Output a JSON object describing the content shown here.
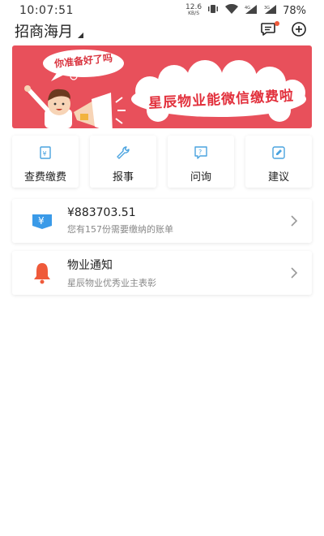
{
  "status_bar": {
    "time": "10:07:51",
    "net_speed_value": "12.6",
    "net_speed_unit": "KB/S",
    "battery": "78%",
    "icons": [
      "vibrate-icon",
      "wifi-icon",
      "signal-4g-icon",
      "signal-3g-icon"
    ]
  },
  "header": {
    "location": "招商海月",
    "icons": [
      "message-icon",
      "add-circle-icon"
    ],
    "accent": "#ef5a3a"
  },
  "banner": {
    "bubble_text": "你准备好了吗",
    "headline": "星辰物业能微信缴费啦",
    "bg_color": "#e8505b"
  },
  "quick_actions": [
    {
      "label": "查费缴费",
      "icon": "bill-icon"
    },
    {
      "label": "报事",
      "icon": "wrench-icon"
    },
    {
      "label": "问询",
      "icon": "question-icon"
    },
    {
      "label": "建议",
      "icon": "edit-icon"
    }
  ],
  "bill_card": {
    "amount": "¥883703.51",
    "subtitle": "您有157份需要缴纳的账单",
    "icon": "yen-card-icon",
    "icon_color": "#3a9ae8"
  },
  "notice_card": {
    "title": "物业通知",
    "subtitle": "星辰物业优秀业主表彰",
    "icon": "bell-icon",
    "icon_color": "#ef5a3a"
  }
}
